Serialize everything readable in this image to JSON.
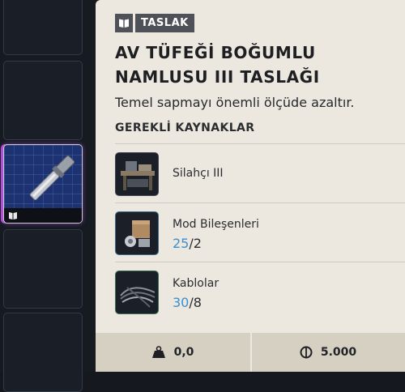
{
  "tag": {
    "label": "TASLAK",
    "icon": "blueprint-icon"
  },
  "item": {
    "title_line1": "AV TÜFEĞİ BOĞUMLU",
    "title_line2": "NAMLUSU III TASLAĞI",
    "description": "Temel sapmayı önemli ölçüde azaltır."
  },
  "section_title": "GEREKLİ KAYNAKLAR",
  "resources": [
    {
      "name": "Silahçı III",
      "have": null,
      "need": null,
      "icon": "workbench-icon"
    },
    {
      "name": "Mod Bileşenleri",
      "have": "25",
      "need": "2",
      "icon": "mod-components-icon"
    },
    {
      "name": "Kablolar",
      "have": "30",
      "need": "8",
      "icon": "cables-icon"
    }
  ],
  "footer": {
    "weight": "0,0",
    "price": "5.000",
    "weight_icon": "weight-icon",
    "price_icon": "coin-icon"
  },
  "colors": {
    "panel_bg": "#ece8df",
    "tag_bg": "#4e5157",
    "count_have": "#3b8fd0",
    "selected_slot": "#1d3270",
    "selected_glow": "#b34fd6"
  }
}
